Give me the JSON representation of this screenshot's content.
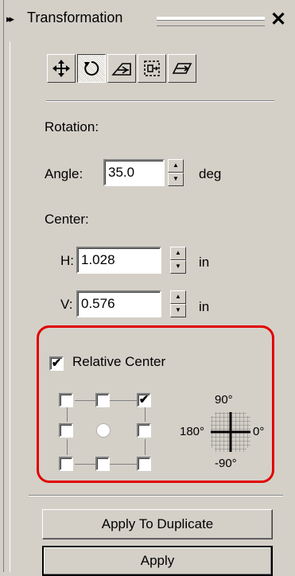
{
  "window": {
    "title": "Transformation",
    "close_symbol": "✕",
    "collapse_symbol": "▸▸"
  },
  "toolbar": {
    "items": [
      "position",
      "rotate",
      "scale",
      "size",
      "skew"
    ],
    "active": "rotate"
  },
  "rotation": {
    "section_label": "Rotation:",
    "angle_label": "Angle:",
    "angle_value": "35.0",
    "angle_unit": "deg"
  },
  "center": {
    "section_label": "Center:",
    "h_label": "H:",
    "h_value": "1.028",
    "h_unit": "in",
    "v_label": "V:",
    "v_value": "0.576",
    "v_unit": "in"
  },
  "relative_center": {
    "label": "Relative Center",
    "checked": true,
    "anchor_checked": "top-right",
    "angle_labels": {
      "top": "90°",
      "left": "180°",
      "right": "0°",
      "bottom": "-90°"
    }
  },
  "buttons": {
    "duplicate": "Apply To Duplicate",
    "apply": "Apply"
  },
  "colors": {
    "highlight_ring": "#e00000",
    "panel_bg": "#d4d0c8"
  }
}
